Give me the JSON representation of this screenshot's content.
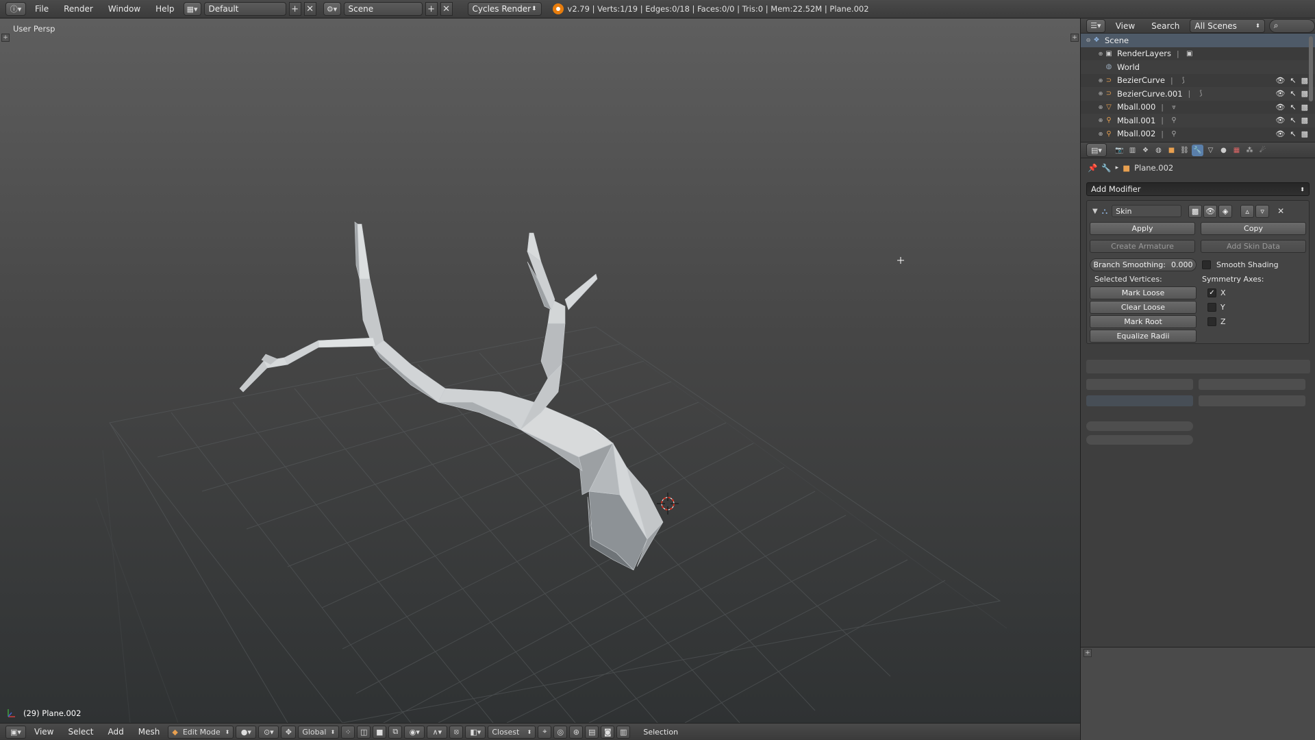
{
  "topbar": {
    "menus": [
      "File",
      "Render",
      "Window",
      "Help"
    ],
    "layout": "Default",
    "scene": "Scene",
    "engine": "Cycles Render",
    "stats": "v2.79 | Verts:1/19 | Edges:0/18 | Faces:0/0 | Tris:0 | Mem:22.52M | Plane.002"
  },
  "viewport": {
    "view_label": "User Persp",
    "object_label": "(29) Plane.002"
  },
  "bottombar": {
    "menus": [
      "View",
      "Select",
      "Add",
      "Mesh"
    ],
    "mode": "Edit Mode",
    "orientation": "Global",
    "snap_target": "Closest",
    "status": "Selection"
  },
  "outliner": {
    "menus": [
      "View",
      "Search"
    ],
    "filter": "All Scenes",
    "rows": [
      {
        "name": "Scene",
        "icon": "scene-icon",
        "indent": 0
      },
      {
        "name": "RenderLayers",
        "icon": "render-layers-icon",
        "indent": 1
      },
      {
        "name": "World",
        "icon": "world-icon",
        "indent": 1
      },
      {
        "name": "BezierCurve",
        "icon": "curve-icon",
        "indent": 1
      },
      {
        "name": "BezierCurve.001",
        "icon": "curve-icon",
        "indent": 1
      },
      {
        "name": "Mball.000",
        "icon": "mesh-icon",
        "indent": 1
      },
      {
        "name": "Mball.001",
        "icon": "metaball-icon",
        "indent": 1
      },
      {
        "name": "Mball.002",
        "icon": "metaball-icon",
        "indent": 1
      }
    ]
  },
  "properties": {
    "context_object": "Plane.002",
    "add_modifier": "Add Modifier",
    "modifier": {
      "name": "Skin",
      "apply": "Apply",
      "copy": "Copy",
      "create_armature": "Create Armature",
      "add_skin_data": "Add Skin Data",
      "branch_smoothing_label": "Branch Smoothing:",
      "branch_smoothing_value": "0.000",
      "smooth_shading": "Smooth Shading",
      "selected_vertices": "Selected Vertices:",
      "symmetry_axes": "Symmetry Axes:",
      "mark_loose": "Mark Loose",
      "clear_loose": "Clear Loose",
      "mark_root": "Mark Root",
      "equalize_radii": "Equalize Radii",
      "axis_x": "X",
      "axis_y": "Y",
      "axis_z": "Z",
      "x_checked": true,
      "y_checked": false,
      "z_checked": false
    }
  },
  "colors": {
    "accent": "#5a7faa",
    "selection_row": "#4e5a68",
    "blender_orange": "#e87d0d"
  }
}
